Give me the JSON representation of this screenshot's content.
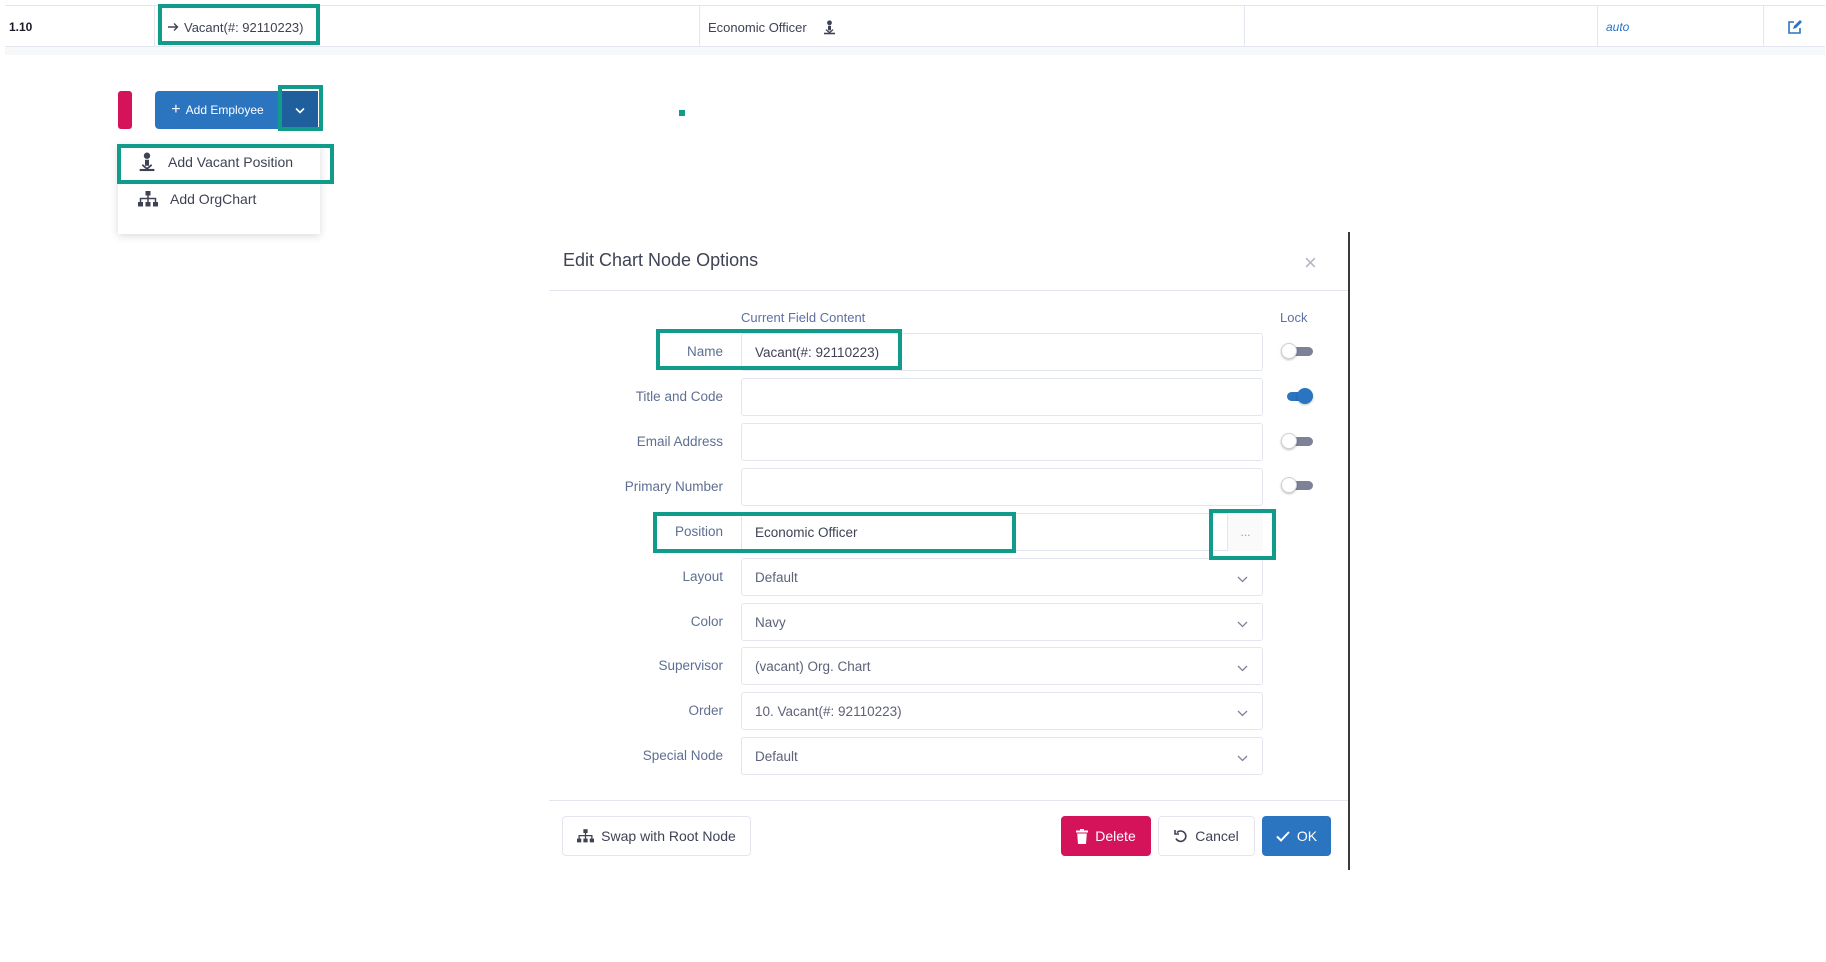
{
  "table_row": {
    "number": "1.10",
    "name": "Vacant(#: 92110223)",
    "position": "Economic Officer",
    "mode": "auto"
  },
  "toolbar": {
    "add_employee_label": "Add Employee",
    "dropdown": {
      "items": [
        {
          "label": "Add Vacant Position",
          "icon": "vacant-person-icon"
        },
        {
          "label": "Add OrgChart",
          "icon": "sitemap-icon"
        }
      ]
    }
  },
  "modal": {
    "title": "Edit Chart Node Options",
    "column_header_content": "Current Field Content",
    "column_header_lock": "Lock",
    "fields": {
      "name": {
        "label": "Name",
        "value": "Vacant(#: 92110223)",
        "locked": false
      },
      "title_code": {
        "label": "Title and Code",
        "value": "",
        "locked": true
      },
      "email": {
        "label": "Email Address",
        "value": "",
        "locked": false
      },
      "primary_number": {
        "label": "Primary Number",
        "value": "",
        "locked": false
      },
      "position": {
        "label": "Position",
        "value": "Economic Officer",
        "button": "..."
      },
      "layout": {
        "label": "Layout",
        "value": "Default"
      },
      "color": {
        "label": "Color",
        "value": "Navy"
      },
      "supervisor": {
        "label": "Supervisor",
        "value": "(vacant) Org. Chart"
      },
      "order": {
        "label": "Order",
        "value": "10. Vacant(#: 92110223)"
      },
      "special_node": {
        "label": "Special Node",
        "value": "Default"
      }
    },
    "footer": {
      "swap_label": "Swap with Root Node",
      "delete_label": "Delete",
      "cancel_label": "Cancel",
      "ok_label": "OK"
    }
  },
  "colors": {
    "accent_blue": "#2b74c0",
    "delete_red": "#d4135a",
    "highlight_teal": "#119b8b"
  }
}
